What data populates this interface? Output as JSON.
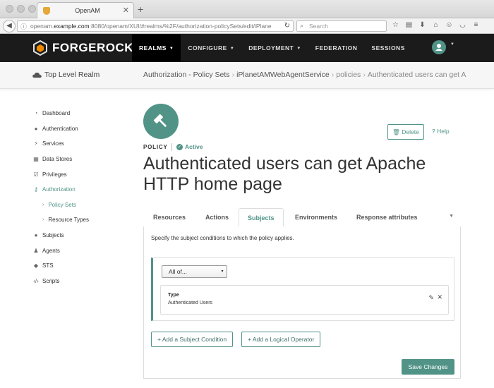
{
  "colors": {
    "accent": "#519387",
    "header_bg": "#1b1b1b"
  },
  "browser": {
    "tab_title": "OpenAM",
    "url_prefix": "openam.",
    "url_host": "example.com",
    "url_rest": ":8080/openam/XUI/#realms/%2F/authorization-policySets/edit/iPlane",
    "search_placeholder": "Search"
  },
  "header": {
    "logo_text": "FORGEROCK",
    "nav": [
      {
        "label": "REALMS",
        "active": true
      },
      {
        "label": "CONFIGURE"
      },
      {
        "label": "DEPLOYMENT"
      },
      {
        "label": "FEDERATION"
      },
      {
        "label": "SESSIONS"
      }
    ]
  },
  "breadcrumb": {
    "realm": "Top Level Realm",
    "items": [
      "Authorization - Policy Sets",
      "iPlanetAMWebAgentService",
      "policies",
      "Authenticated users can get A"
    ]
  },
  "sidebar": {
    "items": [
      {
        "label": "Dashboard",
        "icon": "dashboard-icon"
      },
      {
        "label": "Authentication",
        "icon": "user-icon"
      },
      {
        "label": "Services",
        "icon": "plug-icon"
      },
      {
        "label": "Data Stores",
        "icon": "datastore-icon"
      },
      {
        "label": "Privileges",
        "icon": "checkbox-icon"
      },
      {
        "label": "Authorization",
        "icon": "key-icon",
        "active": true
      },
      {
        "label": "Policy Sets",
        "sub": true,
        "active": true
      },
      {
        "label": "Resource Types",
        "sub": true
      },
      {
        "label": "Subjects",
        "icon": "users-icon"
      },
      {
        "label": "Agents",
        "icon": "agent-icon"
      },
      {
        "label": "STS",
        "icon": "tag-icon"
      },
      {
        "label": "Scripts",
        "icon": "code-icon"
      }
    ]
  },
  "policy": {
    "type_label": "POLICY",
    "status": "Active",
    "title": "Authenticated users can get Apache HTTP home page",
    "delete_label": "Delete",
    "help_label": "Help"
  },
  "tabs": {
    "items": [
      "Resources",
      "Actions",
      "Subjects",
      "Environments",
      "Response attributes"
    ],
    "active": "Subjects"
  },
  "subjects": {
    "description": "Specify the subject conditions to which the policy applies.",
    "operator": "All of...",
    "condition_label": "Type",
    "condition_value": "Authenticated Users",
    "add_condition": "Add a Subject Condition",
    "add_operator": "Add a Logical Operator",
    "save": "Save Changes"
  }
}
